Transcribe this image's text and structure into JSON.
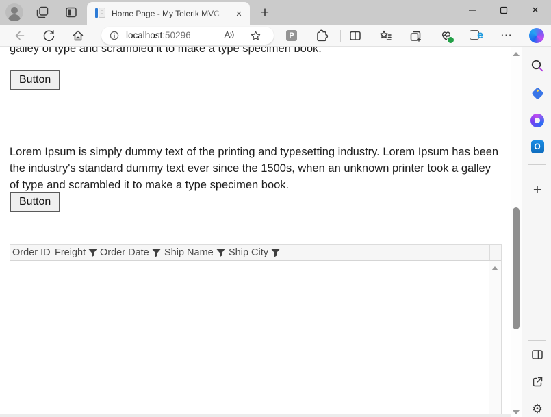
{
  "titlebar": {
    "tab_title": "Home Page - My Telerik MVC Ap",
    "tab_close_glyph": "✕",
    "new_tab_glyph": "+",
    "window_close_glyph": "✕"
  },
  "toolbar": {
    "url": {
      "host": "localhost",
      "port": ":50296"
    },
    "read_aloud_glyph": "A",
    "p_extension_glyph": "P",
    "ie_mode_glyph": "e",
    "more_glyph": "⋯"
  },
  "sidebar": {
    "icon_names": [
      "search",
      "shopping",
      "microsoft-365",
      "outlook",
      "add",
      "split-window",
      "open-external",
      "settings"
    ],
    "add_glyph": "+",
    "settings_glyph": "⚙"
  },
  "page": {
    "clipped_line": "galley of type and scrambled it to make a type specimen book.",
    "button_top_label": "Button",
    "paragraph": "Lorem Ipsum is simply dummy text of the printing and typesetting industry. Lorem Ipsum has been the industry's standard dummy text ever since the 1500s, when an unknown printer took a galley of type and scrambled it to make a type specimen book.",
    "button_bottom_label": "Button",
    "grid": {
      "columns": [
        {
          "label": "Order ID",
          "filterable": false
        },
        {
          "label": "Freight",
          "filterable": true
        },
        {
          "label": "Order Date",
          "filterable": true
        },
        {
          "label": "Ship Name",
          "filterable": true
        },
        {
          "label": "Ship City",
          "filterable": true
        }
      ]
    }
  },
  "colors": {
    "titlebar_bg": "#cbcbcb",
    "chrome_bg": "#f7f7f7",
    "scroll_thumb": "#8f8f8f",
    "tag_blue": "#3a76e8",
    "outlook_blue": "#0f6cbd",
    "essentials_check_green": "#23a047",
    "search_handle_purple": "#b13fe0",
    "favicon_blue": "#2e7cd6"
  }
}
